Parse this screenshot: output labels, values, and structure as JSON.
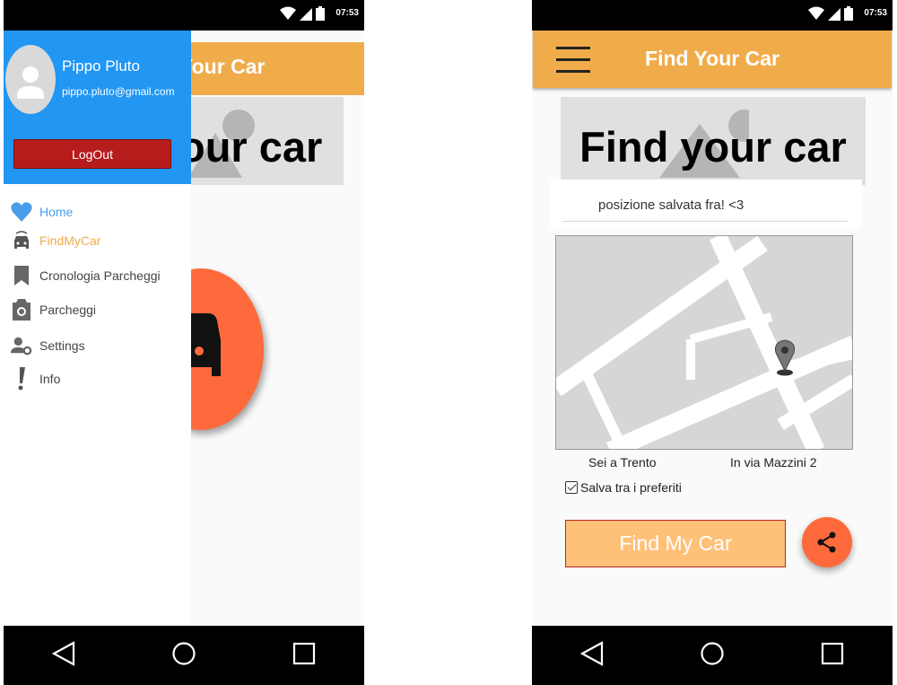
{
  "status_bar": {
    "time": "07:53"
  },
  "left_screen": {
    "app_title_partial": "Your Car",
    "banner_text_partial": "our car",
    "drawer": {
      "user_name": "Pippo Pluto",
      "user_email": "pippo.pluto@gmail.com",
      "logout_label": "LogOut",
      "menu": [
        {
          "label": "Home",
          "icon": "heart-icon",
          "color": "#4a9ee8"
        },
        {
          "label": "FindMyCar",
          "icon": "taxi-icon",
          "color": "#f0ac4b"
        },
        {
          "label": "Cronologia Parcheggi",
          "icon": "bookmark-icon",
          "color": "#444444"
        },
        {
          "label": "Parcheggi",
          "icon": "camera-icon",
          "color": "#444444"
        },
        {
          "label": "Settings",
          "icon": "user-settings-icon",
          "color": "#444444"
        },
        {
          "label": "Info",
          "icon": "info-icon",
          "color": "#444444"
        }
      ]
    }
  },
  "right_screen": {
    "app_title": "Find Your Car",
    "banner_text": "Find your car",
    "saved_position_text": "posizione salvata fra! <3",
    "city_label": "Sei a Trento",
    "street_label": "In via Mazzini 2",
    "favorites_checkbox_label": "Salva tra i preferiti",
    "favorites_checked": true,
    "find_button_label": "Find My Car"
  },
  "colors": {
    "appbar": "#f0ac4b",
    "drawer_header": "#2196f3",
    "logout": "#b71c1c",
    "fab": "#ff6a3c",
    "find_button": "#ffc077"
  }
}
